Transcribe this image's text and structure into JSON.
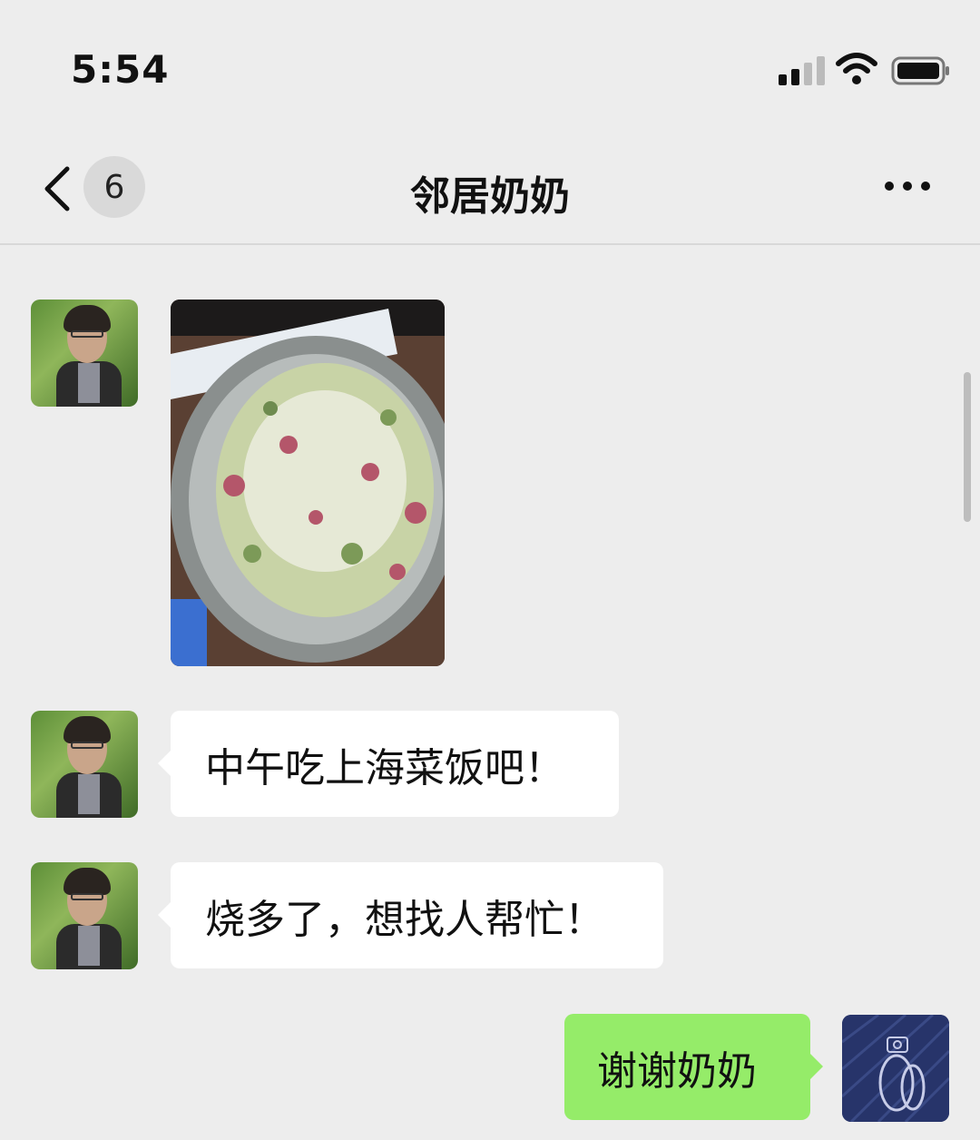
{
  "status_bar": {
    "time": "5:54"
  },
  "nav": {
    "unread_count": "6",
    "title": "邻居奶奶"
  },
  "messages": [
    {
      "sender": "neighbor",
      "type": "image",
      "image_desc": "food-photo"
    },
    {
      "sender": "neighbor",
      "type": "text",
      "text": "中午吃上海菜饭吧！"
    },
    {
      "sender": "neighbor",
      "type": "text",
      "text": "烧多了，想找人帮忙！"
    },
    {
      "sender": "self",
      "type": "text",
      "text": "谢谢奶奶"
    }
  ],
  "colors": {
    "background": "#ededed",
    "incoming_bubble": "#ffffff",
    "outgoing_bubble": "#95ec69"
  }
}
